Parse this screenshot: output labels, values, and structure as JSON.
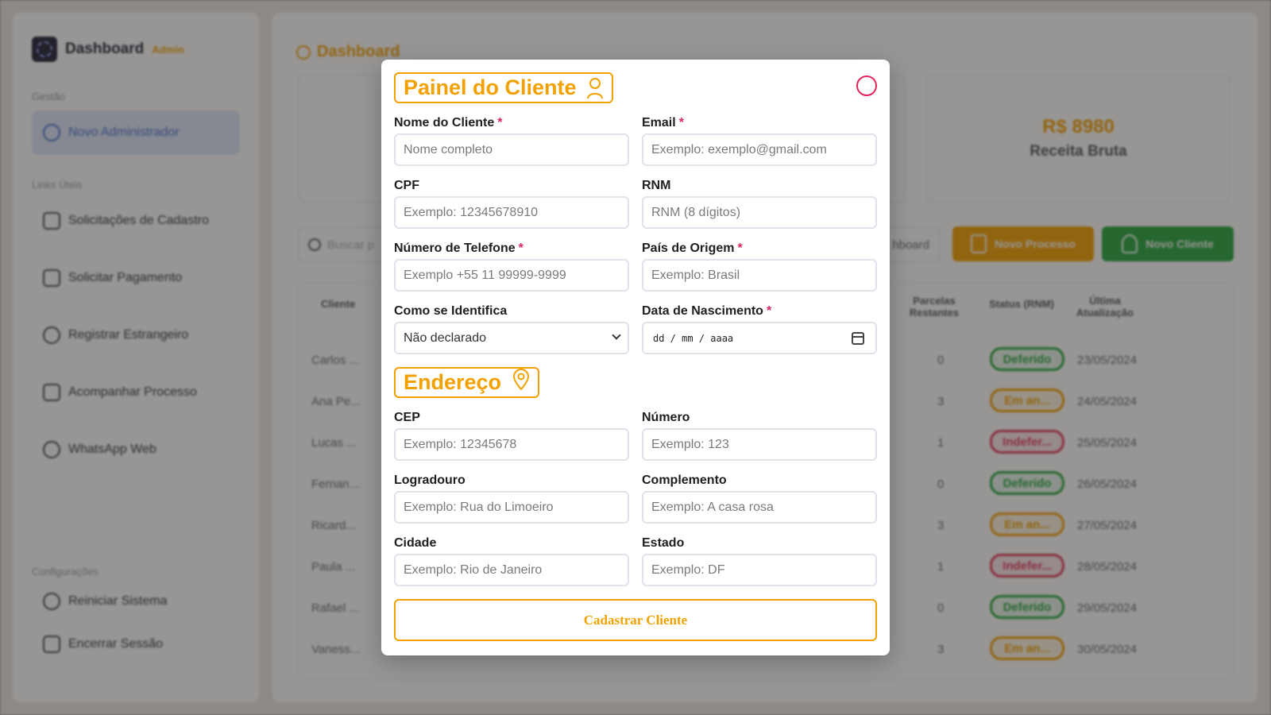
{
  "sidebar": {
    "brand_title": "Dashboard",
    "brand_sub": "Admin",
    "section_gestao": "Gestão",
    "item_novo_admin": "Novo Administrador",
    "section_links": "Links Úteis",
    "links": [
      "Solicitações de Cadastro",
      "Solicitar Pagamento",
      "Registrar Estrangeiro",
      "Acompanhar Processo",
      "WhatsApp Web"
    ],
    "section_config": "Configurações",
    "item_reiniciar": "Reiniciar Sistema",
    "item_encerrar": "Encerrar Sessão"
  },
  "main": {
    "title": "Dashboard",
    "stat_value": "R$ 8980",
    "stat_label": "Receita Bruta",
    "search_placeholder": "Buscar p",
    "filter_label": "hboard",
    "btn_novo_processo": "Novo Processo",
    "btn_novo_cliente": "Novo Cliente",
    "columns": {
      "cliente": "Cliente",
      "parcelas": "Parcelas Restantes",
      "status": "Status (RNM)",
      "atualizacao": "Última Atualização"
    },
    "rows": [
      {
        "cliente": "Carlos ...",
        "parcelas": "0",
        "status": "Deferido",
        "kind": "ok",
        "data": "23/05/2024"
      },
      {
        "cliente": "Ana Pe...",
        "parcelas": "3",
        "status": "Em an...",
        "kind": "an",
        "data": "24/05/2024"
      },
      {
        "cliente": "Lucas ...",
        "parcelas": "1",
        "status": "Indefer...",
        "kind": "no",
        "data": "25/05/2024"
      },
      {
        "cliente": "Fernan...",
        "parcelas": "0",
        "status": "Deferido",
        "kind": "ok",
        "data": "26/05/2024"
      },
      {
        "cliente": "Ricard...",
        "parcelas": "3",
        "status": "Em an...",
        "kind": "an",
        "data": "27/05/2024"
      },
      {
        "cliente": "Paula ...",
        "parcelas": "1",
        "status": "Indefer...",
        "kind": "no",
        "data": "28/05/2024"
      },
      {
        "cliente": "Rafael ...",
        "parcelas": "0",
        "status": "Deferido",
        "kind": "ok",
        "data": "29/05/2024"
      },
      {
        "cliente": "Vaness...",
        "parcelas": "3",
        "status": "Em an...",
        "kind": "an",
        "data": "30/05/2024"
      }
    ]
  },
  "modal": {
    "title": "Painel do Cliente",
    "address_title": "Endereço",
    "fields": {
      "nome": {
        "label": "Nome do Cliente",
        "placeholder": "Nome completo"
      },
      "email": {
        "label": "Email",
        "placeholder": "Exemplo: exemplo@gmail.com"
      },
      "cpf": {
        "label": "CPF",
        "placeholder": "Exemplo: 12345678910"
      },
      "rnm": {
        "label": "RNM",
        "placeholder": "RNM (8 dígitos)"
      },
      "telefone": {
        "label": "Número de Telefone",
        "placeholder": "Exemplo +55 11 99999-9999"
      },
      "pais": {
        "label": "País de Origem",
        "placeholder": "Exemplo: Brasil"
      },
      "identifica": {
        "label": "Como se Identifica",
        "value": "Não declarado"
      },
      "nascimento": {
        "label": "Data de Nascimento",
        "value": "dd / mm / aaaa"
      },
      "cep": {
        "label": "CEP",
        "placeholder": "Exemplo: 12345678"
      },
      "numero": {
        "label": "Número",
        "placeholder": "Exemplo: 123"
      },
      "logradouro": {
        "label": "Logradouro",
        "placeholder": "Exemplo: Rua do Limoeiro"
      },
      "complemento": {
        "label": "Complemento",
        "placeholder": "Exemplo: A casa rosa"
      },
      "cidade": {
        "label": "Cidade",
        "placeholder": "Exemplo: Rio de Janeiro"
      },
      "estado": {
        "label": "Estado",
        "placeholder": "Exemplo: DF"
      }
    },
    "required_mark": "*",
    "submit_label": "Cadastrar Cliente"
  },
  "colors": {
    "accent": "#f2a100",
    "required": "#e3245a",
    "success": "#23a63b"
  }
}
